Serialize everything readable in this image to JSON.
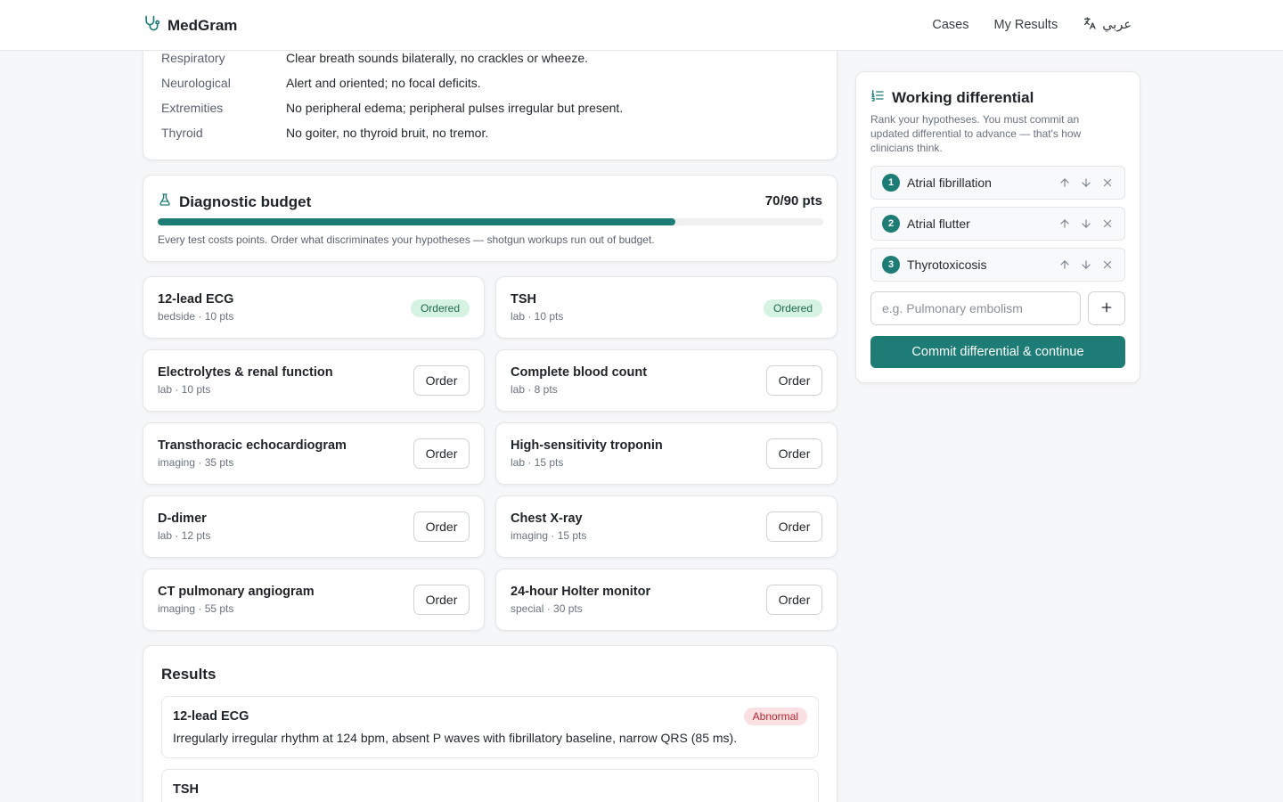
{
  "header": {
    "brand": "MedGram",
    "nav": [
      "Cases",
      "My Results"
    ],
    "language_label": "عربي"
  },
  "exam": {
    "rows": [
      {
        "system": "Respiratory",
        "finding": "Clear breath sounds bilaterally, no crackles or wheeze."
      },
      {
        "system": "Neurological",
        "finding": "Alert and oriented; no focal deficits."
      },
      {
        "system": "Extremities",
        "finding": "No peripheral edema; peripheral pulses irregular but present."
      },
      {
        "system": "Thyroid",
        "finding": "No goiter, no thyroid bruit, no tremor."
      }
    ]
  },
  "budget": {
    "title": "Diagnostic budget",
    "points_label": "70/90 pts",
    "used_fraction": 0.7778,
    "note": "Every test costs points. Order what discriminates your hypotheses — shotgun workups run out of budget."
  },
  "tests": [
    {
      "name": "12-lead ECG",
      "meta": "bedside · 10 pts",
      "status": "Ordered"
    },
    {
      "name": "TSH",
      "meta": "lab · 10 pts",
      "status": "Ordered"
    },
    {
      "name": "Electrolytes & renal function",
      "meta": "lab · 10 pts",
      "action": "Order"
    },
    {
      "name": "Complete blood count",
      "meta": "lab · 8 pts",
      "action": "Order"
    },
    {
      "name": "Transthoracic echocardiogram",
      "meta": "imaging · 35 pts",
      "action": "Order"
    },
    {
      "name": "High-sensitivity troponin",
      "meta": "lab · 15 pts",
      "action": "Order"
    },
    {
      "name": "D-dimer",
      "meta": "lab · 12 pts",
      "action": "Order"
    },
    {
      "name": "Chest X-ray",
      "meta": "imaging · 15 pts",
      "action": "Order"
    },
    {
      "name": "CT pulmonary angiogram",
      "meta": "imaging · 55 pts",
      "action": "Order"
    },
    {
      "name": "24-hour Holter monitor",
      "meta": "special · 30 pts",
      "action": "Order"
    }
  ],
  "results": {
    "title": "Results",
    "items": [
      {
        "name": "12-lead ECG",
        "badge": "Abnormal",
        "text": "Irregularly irregular rhythm at 124 bpm, absent P waves with fibrillatory baseline, narrow QRS (85 ms)."
      },
      {
        "name": "TSH"
      }
    ]
  },
  "differential": {
    "title": "Working differential",
    "description": "Rank your hypotheses. You must commit an updated differential to advance — that's how clinicians think.",
    "items": [
      {
        "rank": "1",
        "label": "Atrial fibrillation"
      },
      {
        "rank": "2",
        "label": "Atrial flutter"
      },
      {
        "rank": "3",
        "label": "Thyrotoxicosis"
      }
    ],
    "input_placeholder": "e.g. Pulmonary embolism",
    "commit_label": "Commit differential & continue"
  },
  "colors": {
    "accent": "#1e7c76",
    "ordered_bg": "#d5f2e3",
    "abnormal_bg": "#fbe0e3"
  }
}
